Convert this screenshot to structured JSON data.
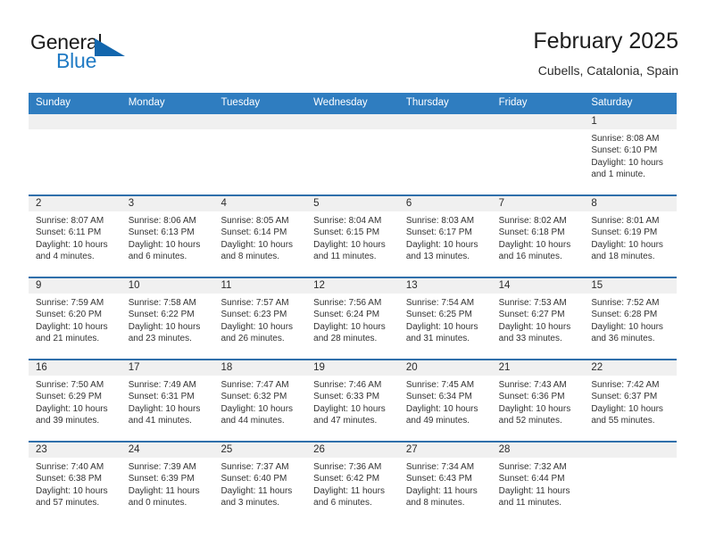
{
  "brand": {
    "name_part1": "General",
    "name_part2": "Blue",
    "triangle_icon": "triangle-icon",
    "accent_color": "#1f7ac4",
    "dark_color": "#1266ad"
  },
  "header": {
    "title": "February 2025",
    "location": "Cubells, Catalonia, Spain"
  },
  "theme": {
    "header_blue": "#2f7dc0",
    "row_divider_blue": "#2f6fab",
    "day_band_gray": "#f0f0f0"
  },
  "weekdays": [
    "Sunday",
    "Monday",
    "Tuesday",
    "Wednesday",
    "Thursday",
    "Friday",
    "Saturday"
  ],
  "weeks": [
    [
      {
        "day": "",
        "sunrise": "",
        "sunset": "",
        "daylight1": "",
        "daylight2": "",
        "empty": true
      },
      {
        "day": "",
        "sunrise": "",
        "sunset": "",
        "daylight1": "",
        "daylight2": "",
        "empty": true
      },
      {
        "day": "",
        "sunrise": "",
        "sunset": "",
        "daylight1": "",
        "daylight2": "",
        "empty": true
      },
      {
        "day": "",
        "sunrise": "",
        "sunset": "",
        "daylight1": "",
        "daylight2": "",
        "empty": true
      },
      {
        "day": "",
        "sunrise": "",
        "sunset": "",
        "daylight1": "",
        "daylight2": "",
        "empty": true
      },
      {
        "day": "",
        "sunrise": "",
        "sunset": "",
        "daylight1": "",
        "daylight2": "",
        "empty": true
      },
      {
        "day": "1",
        "sunrise": "Sunrise: 8:08 AM",
        "sunset": "Sunset: 6:10 PM",
        "daylight1": "Daylight: 10 hours",
        "daylight2": "and 1 minute.",
        "empty": false
      }
    ],
    [
      {
        "day": "2",
        "sunrise": "Sunrise: 8:07 AM",
        "sunset": "Sunset: 6:11 PM",
        "daylight1": "Daylight: 10 hours",
        "daylight2": "and 4 minutes.",
        "empty": false
      },
      {
        "day": "3",
        "sunrise": "Sunrise: 8:06 AM",
        "sunset": "Sunset: 6:13 PM",
        "daylight1": "Daylight: 10 hours",
        "daylight2": "and 6 minutes.",
        "empty": false
      },
      {
        "day": "4",
        "sunrise": "Sunrise: 8:05 AM",
        "sunset": "Sunset: 6:14 PM",
        "daylight1": "Daylight: 10 hours",
        "daylight2": "and 8 minutes.",
        "empty": false
      },
      {
        "day": "5",
        "sunrise": "Sunrise: 8:04 AM",
        "sunset": "Sunset: 6:15 PM",
        "daylight1": "Daylight: 10 hours",
        "daylight2": "and 11 minutes.",
        "empty": false
      },
      {
        "day": "6",
        "sunrise": "Sunrise: 8:03 AM",
        "sunset": "Sunset: 6:17 PM",
        "daylight1": "Daylight: 10 hours",
        "daylight2": "and 13 minutes.",
        "empty": false
      },
      {
        "day": "7",
        "sunrise": "Sunrise: 8:02 AM",
        "sunset": "Sunset: 6:18 PM",
        "daylight1": "Daylight: 10 hours",
        "daylight2": "and 16 minutes.",
        "empty": false
      },
      {
        "day": "8",
        "sunrise": "Sunrise: 8:01 AM",
        "sunset": "Sunset: 6:19 PM",
        "daylight1": "Daylight: 10 hours",
        "daylight2": "and 18 minutes.",
        "empty": false
      }
    ],
    [
      {
        "day": "9",
        "sunrise": "Sunrise: 7:59 AM",
        "sunset": "Sunset: 6:20 PM",
        "daylight1": "Daylight: 10 hours",
        "daylight2": "and 21 minutes.",
        "empty": false
      },
      {
        "day": "10",
        "sunrise": "Sunrise: 7:58 AM",
        "sunset": "Sunset: 6:22 PM",
        "daylight1": "Daylight: 10 hours",
        "daylight2": "and 23 minutes.",
        "empty": false
      },
      {
        "day": "11",
        "sunrise": "Sunrise: 7:57 AM",
        "sunset": "Sunset: 6:23 PM",
        "daylight1": "Daylight: 10 hours",
        "daylight2": "and 26 minutes.",
        "empty": false
      },
      {
        "day": "12",
        "sunrise": "Sunrise: 7:56 AM",
        "sunset": "Sunset: 6:24 PM",
        "daylight1": "Daylight: 10 hours",
        "daylight2": "and 28 minutes.",
        "empty": false
      },
      {
        "day": "13",
        "sunrise": "Sunrise: 7:54 AM",
        "sunset": "Sunset: 6:25 PM",
        "daylight1": "Daylight: 10 hours",
        "daylight2": "and 31 minutes.",
        "empty": false
      },
      {
        "day": "14",
        "sunrise": "Sunrise: 7:53 AM",
        "sunset": "Sunset: 6:27 PM",
        "daylight1": "Daylight: 10 hours",
        "daylight2": "and 33 minutes.",
        "empty": false
      },
      {
        "day": "15",
        "sunrise": "Sunrise: 7:52 AM",
        "sunset": "Sunset: 6:28 PM",
        "daylight1": "Daylight: 10 hours",
        "daylight2": "and 36 minutes.",
        "empty": false
      }
    ],
    [
      {
        "day": "16",
        "sunrise": "Sunrise: 7:50 AM",
        "sunset": "Sunset: 6:29 PM",
        "daylight1": "Daylight: 10 hours",
        "daylight2": "and 39 minutes.",
        "empty": false
      },
      {
        "day": "17",
        "sunrise": "Sunrise: 7:49 AM",
        "sunset": "Sunset: 6:31 PM",
        "daylight1": "Daylight: 10 hours",
        "daylight2": "and 41 minutes.",
        "empty": false
      },
      {
        "day": "18",
        "sunrise": "Sunrise: 7:47 AM",
        "sunset": "Sunset: 6:32 PM",
        "daylight1": "Daylight: 10 hours",
        "daylight2": "and 44 minutes.",
        "empty": false
      },
      {
        "day": "19",
        "sunrise": "Sunrise: 7:46 AM",
        "sunset": "Sunset: 6:33 PM",
        "daylight1": "Daylight: 10 hours",
        "daylight2": "and 47 minutes.",
        "empty": false
      },
      {
        "day": "20",
        "sunrise": "Sunrise: 7:45 AM",
        "sunset": "Sunset: 6:34 PM",
        "daylight1": "Daylight: 10 hours",
        "daylight2": "and 49 minutes.",
        "empty": false
      },
      {
        "day": "21",
        "sunrise": "Sunrise: 7:43 AM",
        "sunset": "Sunset: 6:36 PM",
        "daylight1": "Daylight: 10 hours",
        "daylight2": "and 52 minutes.",
        "empty": false
      },
      {
        "day": "22",
        "sunrise": "Sunrise: 7:42 AM",
        "sunset": "Sunset: 6:37 PM",
        "daylight1": "Daylight: 10 hours",
        "daylight2": "and 55 minutes.",
        "empty": false
      }
    ],
    [
      {
        "day": "23",
        "sunrise": "Sunrise: 7:40 AM",
        "sunset": "Sunset: 6:38 PM",
        "daylight1": "Daylight: 10 hours",
        "daylight2": "and 57 minutes.",
        "empty": false
      },
      {
        "day": "24",
        "sunrise": "Sunrise: 7:39 AM",
        "sunset": "Sunset: 6:39 PM",
        "daylight1": "Daylight: 11 hours",
        "daylight2": "and 0 minutes.",
        "empty": false
      },
      {
        "day": "25",
        "sunrise": "Sunrise: 7:37 AM",
        "sunset": "Sunset: 6:40 PM",
        "daylight1": "Daylight: 11 hours",
        "daylight2": "and 3 minutes.",
        "empty": false
      },
      {
        "day": "26",
        "sunrise": "Sunrise: 7:36 AM",
        "sunset": "Sunset: 6:42 PM",
        "daylight1": "Daylight: 11 hours",
        "daylight2": "and 6 minutes.",
        "empty": false
      },
      {
        "day": "27",
        "sunrise": "Sunrise: 7:34 AM",
        "sunset": "Sunset: 6:43 PM",
        "daylight1": "Daylight: 11 hours",
        "daylight2": "and 8 minutes.",
        "empty": false
      },
      {
        "day": "28",
        "sunrise": "Sunrise: 7:32 AM",
        "sunset": "Sunset: 6:44 PM",
        "daylight1": "Daylight: 11 hours",
        "daylight2": "and 11 minutes.",
        "empty": false
      },
      {
        "day": "",
        "sunrise": "",
        "sunset": "",
        "daylight1": "",
        "daylight2": "",
        "empty": true
      }
    ]
  ]
}
